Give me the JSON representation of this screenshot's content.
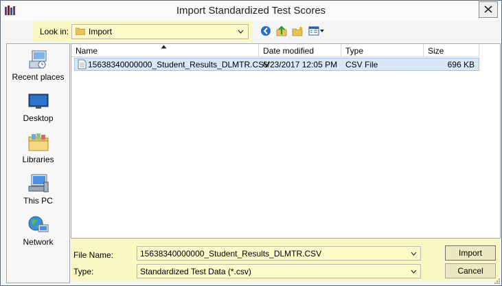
{
  "window": {
    "title": "Import Standardized Test Scores"
  },
  "lookin": {
    "label": "Look in:",
    "value": "Import"
  },
  "toolbar": {
    "icons": [
      "back-icon",
      "up-folder-icon",
      "new-folder-icon",
      "view-menu-icon"
    ]
  },
  "places": [
    {
      "label": "Recent places",
      "icon": "recent-places-icon"
    },
    {
      "label": "Desktop",
      "icon": "desktop-icon"
    },
    {
      "label": "Libraries",
      "icon": "libraries-icon"
    },
    {
      "label": "This PC",
      "icon": "this-pc-icon"
    },
    {
      "label": "Network",
      "icon": "network-icon"
    }
  ],
  "columns": {
    "name": "Name",
    "date": "Date modified",
    "type": "Type",
    "size": "Size"
  },
  "files": [
    {
      "name": "15638340000000_Student_Results_DLMTR.CSV",
      "date": "6/23/2017 12:05 PM",
      "type": "CSV File",
      "size": "696 KB"
    }
  ],
  "bottom": {
    "file_name_label": "File Name:",
    "file_name_value": "15638340000000_Student_Results_DLMTR.CSV",
    "type_label": "Type:",
    "type_value": "Standardized Test Data (*.csv)",
    "import_label": "Import",
    "cancel_label": "Cancel"
  },
  "colors": {
    "highlight": "#fbf7c2",
    "selection": "#d8e8f7"
  }
}
